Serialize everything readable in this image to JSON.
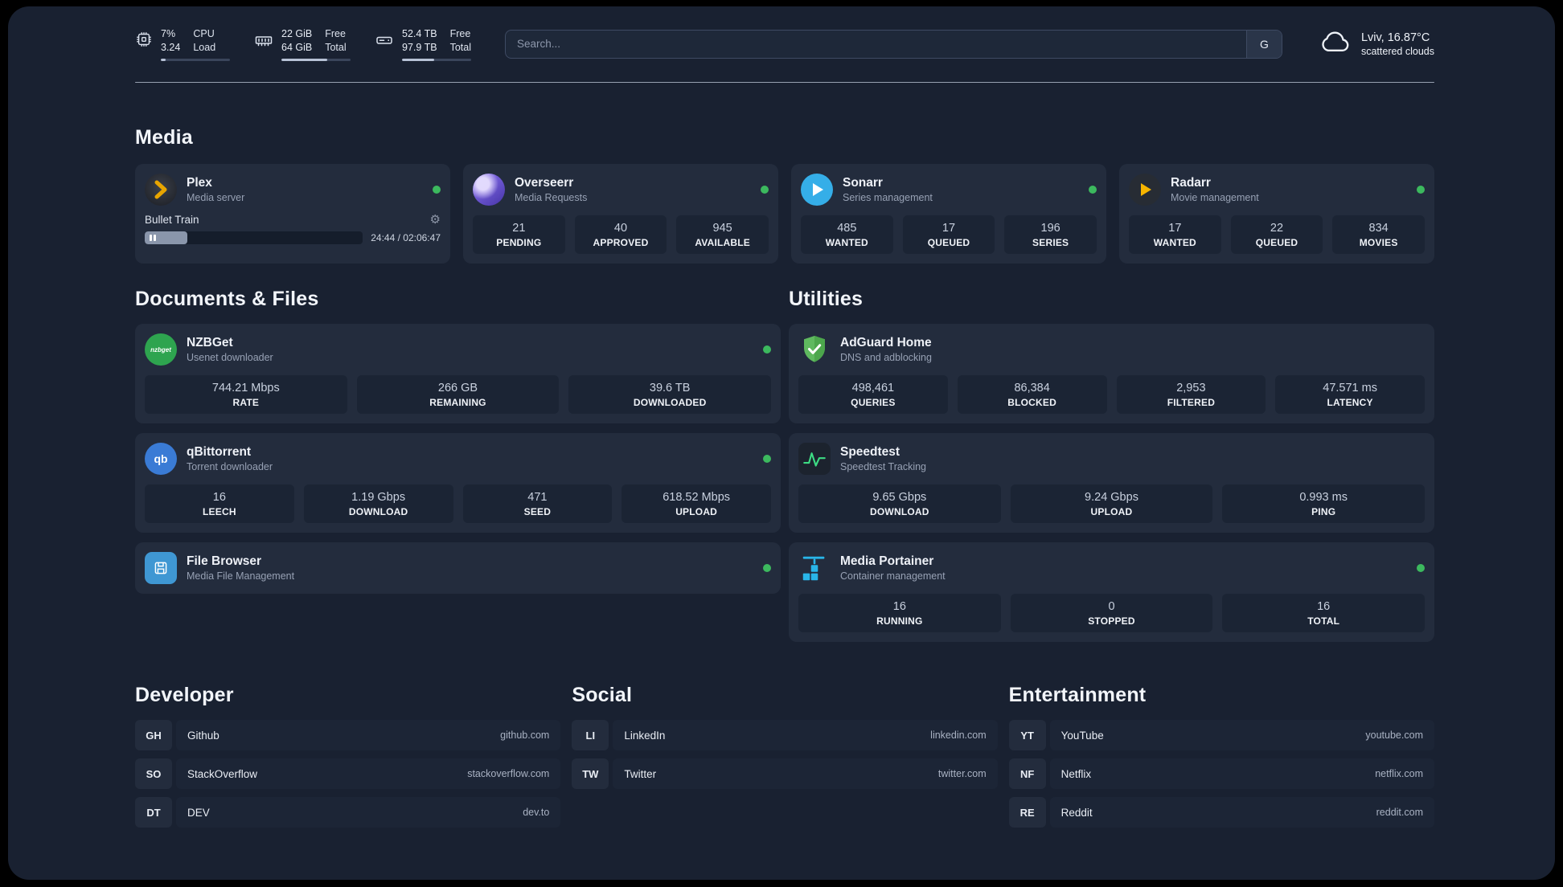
{
  "topbar": {
    "cpu": {
      "value": "7%",
      "sub": "3.24",
      "label_top": "CPU",
      "label_bottom": "Load",
      "progress": 7
    },
    "ram": {
      "value": "22 GiB",
      "sub": "64 GiB",
      "label_top": "Free",
      "label_bottom": "Total",
      "progress": 66
    },
    "disk": {
      "value": "52.4 TB",
      "sub": "97.9 TB",
      "label_top": "Free",
      "label_bottom": "Total",
      "progress": 47
    },
    "search": {
      "placeholder": "Search...",
      "button_label": "G"
    },
    "weather": {
      "location": "Lviv, 16.87°C",
      "condition": "scattered clouds"
    }
  },
  "media": {
    "title": "Media",
    "plex": {
      "name": "Plex",
      "subtitle": "Media server",
      "now_playing": "Bullet Train",
      "time": "24:44 / 02:06:47",
      "progress": 19.5
    },
    "overseerr": {
      "name": "Overseerr",
      "subtitle": "Media Requests",
      "stats": [
        {
          "value": "21",
          "label": "PENDING"
        },
        {
          "value": "40",
          "label": "APPROVED"
        },
        {
          "value": "945",
          "label": "AVAILABLE"
        }
      ]
    },
    "sonarr": {
      "name": "Sonarr",
      "subtitle": "Series management",
      "stats": [
        {
          "value": "485",
          "label": "WANTED"
        },
        {
          "value": "17",
          "label": "QUEUED"
        },
        {
          "value": "196",
          "label": "SERIES"
        }
      ]
    },
    "radarr": {
      "name": "Radarr",
      "subtitle": "Movie management",
      "stats": [
        {
          "value": "17",
          "label": "WANTED"
        },
        {
          "value": "22",
          "label": "QUEUED"
        },
        {
          "value": "834",
          "label": "MOVIES"
        }
      ]
    }
  },
  "documents": {
    "title": "Documents & Files",
    "nzbget": {
      "name": "NZBGet",
      "subtitle": "Usenet downloader",
      "stats": [
        {
          "value": "744.21 Mbps",
          "label": "RATE"
        },
        {
          "value": "266 GB",
          "label": "REMAINING"
        },
        {
          "value": "39.6 TB",
          "label": "DOWNLOADED"
        }
      ]
    },
    "qbittorrent": {
      "name": "qBittorrent",
      "subtitle": "Torrent downloader",
      "stats": [
        {
          "value": "16",
          "label": "LEECH"
        },
        {
          "value": "1.19 Gbps",
          "label": "DOWNLOAD"
        },
        {
          "value": "471",
          "label": "SEED"
        },
        {
          "value": "618.52 Mbps",
          "label": "UPLOAD"
        }
      ]
    },
    "filebrowser": {
      "name": "File Browser",
      "subtitle": "Media File Management"
    }
  },
  "utilities": {
    "title": "Utilities",
    "adguard": {
      "name": "AdGuard Home",
      "subtitle": "DNS and adblocking",
      "stats": [
        {
          "value": "498,461",
          "label": "QUERIES"
        },
        {
          "value": "86,384",
          "label": "BLOCKED"
        },
        {
          "value": "2,953",
          "label": "FILTERED"
        },
        {
          "value": "47.571 ms",
          "label": "LATENCY"
        }
      ]
    },
    "speedtest": {
      "name": "Speedtest",
      "subtitle": "Speedtest Tracking",
      "stats": [
        {
          "value": "9.65 Gbps",
          "label": "DOWNLOAD"
        },
        {
          "value": "9.24 Gbps",
          "label": "UPLOAD"
        },
        {
          "value": "0.993 ms",
          "label": "PING"
        }
      ]
    },
    "portainer": {
      "name": "Media Portainer",
      "subtitle": "Container management",
      "stats": [
        {
          "value": "16",
          "label": "RUNNING"
        },
        {
          "value": "0",
          "label": "STOPPED"
        },
        {
          "value": "16",
          "label": "TOTAL"
        }
      ]
    }
  },
  "bookmarks": {
    "developer": {
      "title": "Developer",
      "items": [
        {
          "abbr": "GH",
          "name": "Github",
          "url": "github.com"
        },
        {
          "abbr": "SO",
          "name": "StackOverflow",
          "url": "stackoverflow.com"
        },
        {
          "abbr": "DT",
          "name": "DEV",
          "url": "dev.to"
        }
      ]
    },
    "social": {
      "title": "Social",
      "items": [
        {
          "abbr": "LI",
          "name": "LinkedIn",
          "url": "linkedin.com"
        },
        {
          "abbr": "TW",
          "name": "Twitter",
          "url": "twitter.com"
        }
      ]
    },
    "entertainment": {
      "title": "Entertainment",
      "items": [
        {
          "abbr": "YT",
          "name": "YouTube",
          "url": "youtube.com"
        },
        {
          "abbr": "NF",
          "name": "Netflix",
          "url": "netflix.com"
        },
        {
          "abbr": "RE",
          "name": "Reddit",
          "url": "reddit.com"
        }
      ]
    }
  },
  "colors": {
    "panel_background": "#192131",
    "card_background": "#232c3d",
    "stat_background": "#1b2434",
    "status_online": "#3cb95e",
    "plex_gold": "#e8a500",
    "adguard_green": "#5fb95f",
    "portainer_blue": "#29b5e8"
  }
}
